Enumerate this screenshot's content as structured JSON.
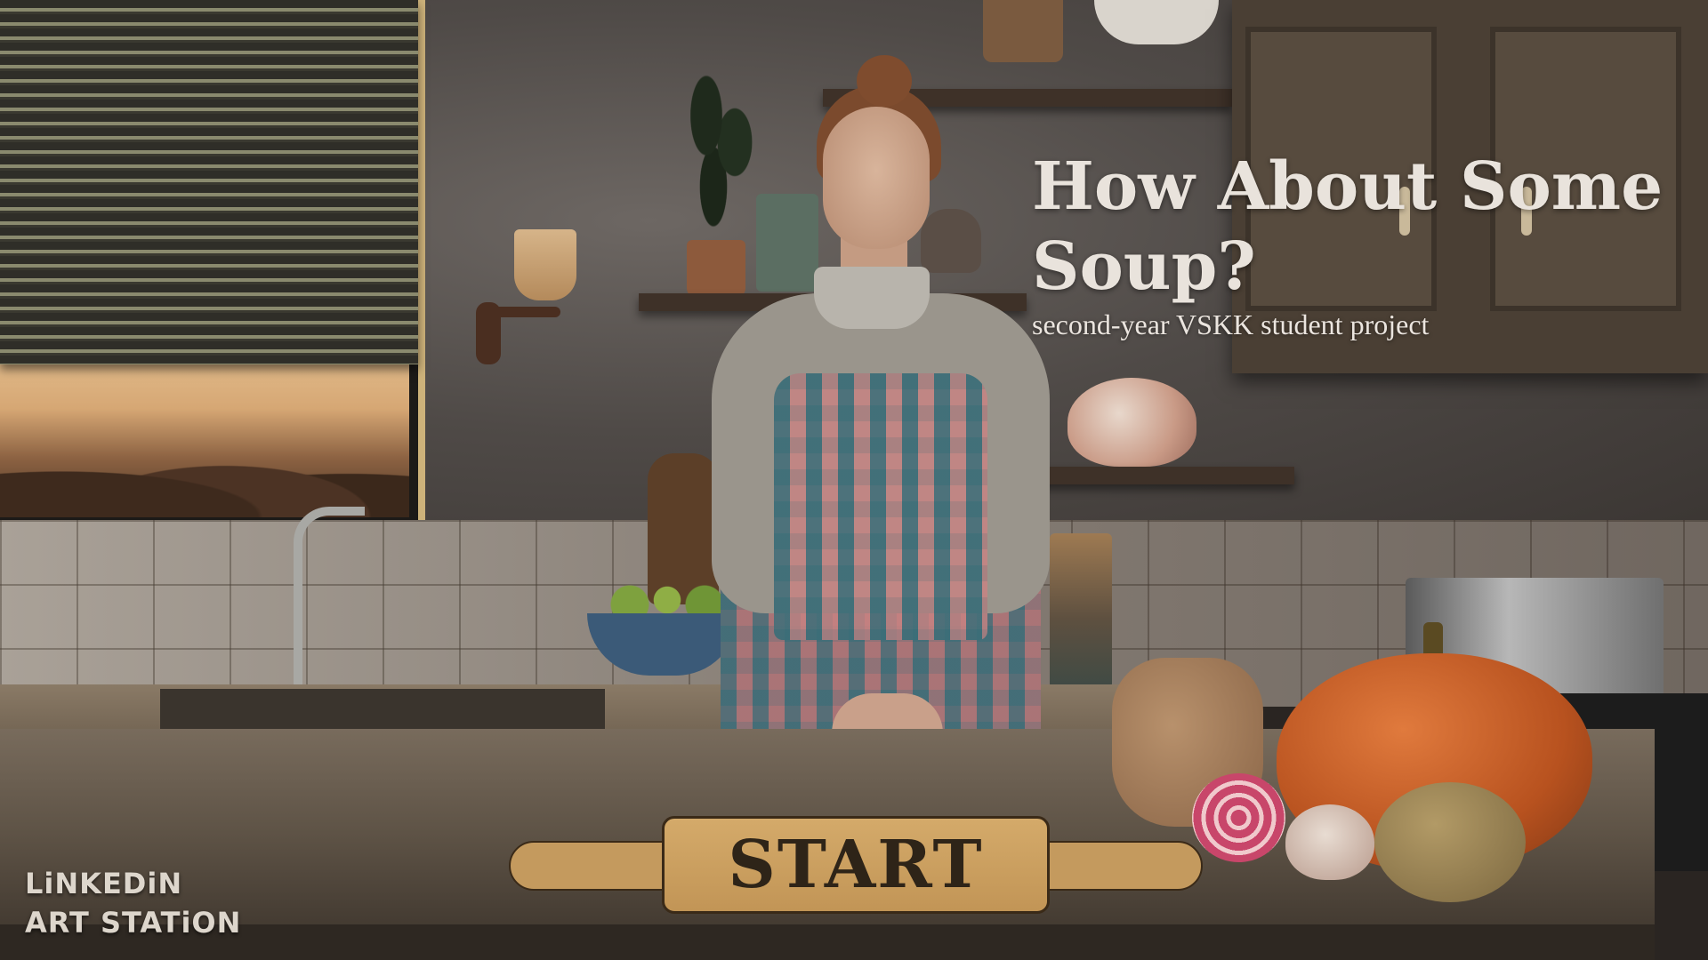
{
  "title": {
    "line1": "How About Some",
    "line2": "Soup?",
    "subtitle": "second-year VSKK student project"
  },
  "start_button": {
    "label": "START"
  },
  "social_links": [
    {
      "label": "LiNKEDiN"
    },
    {
      "label": "ART STATiON"
    }
  ],
  "colors": {
    "title_text": "#e9e3dc",
    "button_wood": "#c99c5f",
    "button_outline": "#3a2a18"
  }
}
